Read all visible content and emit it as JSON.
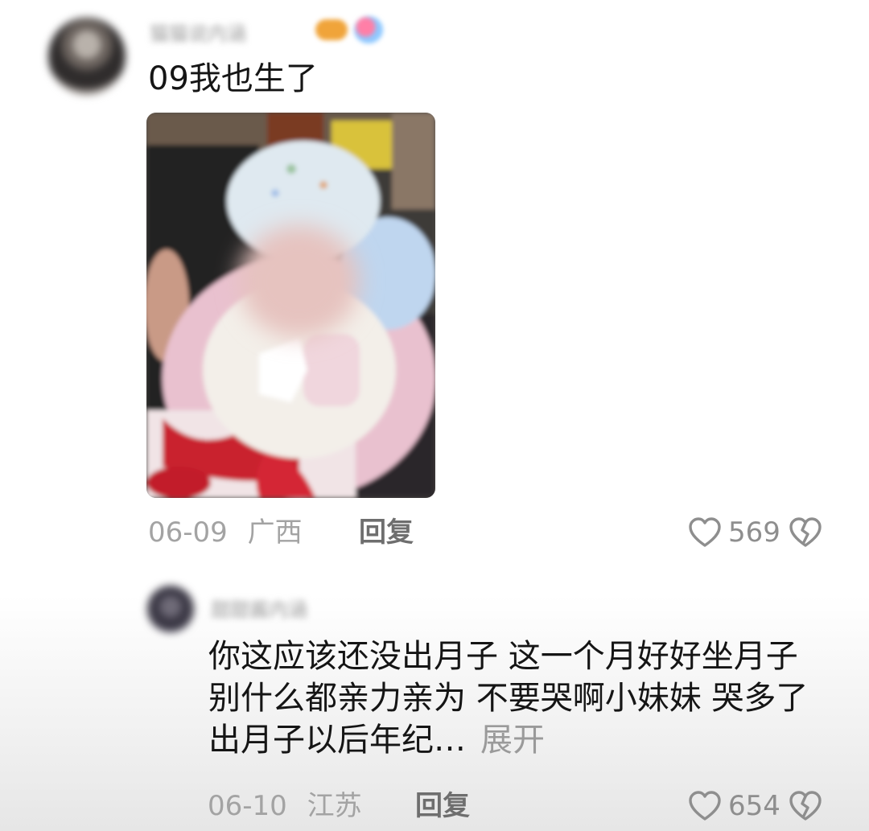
{
  "comment": {
    "username": "猫猫说内涵",
    "text": "09我也生了",
    "date": "06-09",
    "location": "广西",
    "reply_label": "回复",
    "like_count": "569"
  },
  "reply": {
    "username": "甜甜酱内涵",
    "text": "你这应该还没出月子 这一个月好好坐月子 别什么都亲力亲为 不要哭啊小妹妹 哭多了出月子以后年纪…",
    "expand_label": "展开",
    "date": "06-10",
    "location": "江苏",
    "reply_label": "回复",
    "like_count": "654"
  },
  "icons": {
    "like": "heart-outline-icon",
    "dislike": "broken-heart-icon"
  }
}
